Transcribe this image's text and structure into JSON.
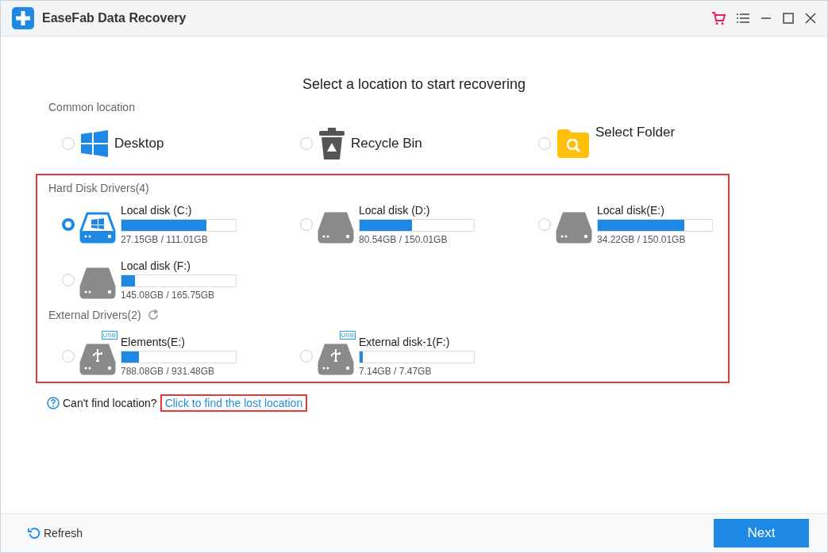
{
  "window": {
    "title": "EaseFab Data Recovery"
  },
  "heading": "Select a location to start recovering",
  "common": {
    "label": "Common location",
    "items": [
      {
        "kind": "desktop",
        "label": "Desktop",
        "selected": false
      },
      {
        "kind": "recycle",
        "label": "Recycle Bin",
        "selected": false
      },
      {
        "kind": "folder",
        "label": "Select Folder",
        "selected": false
      }
    ]
  },
  "hard_disks": {
    "label": "Hard Disk Drivers(4)",
    "highlighted": true,
    "items": [
      {
        "kind": "system",
        "name": "Local disk (C:)",
        "level": 0.74,
        "size": "27.15GB / 111.01GB",
        "selected": true
      },
      {
        "kind": "disk",
        "name": "Local disk (D:)",
        "level": 0.46,
        "size": "80.54GB / 150.01GB",
        "selected": false
      },
      {
        "kind": "disk",
        "name": "Local disk(E:)",
        "level": 0.76,
        "size": "34.22GB / 150.01GB",
        "selected": false
      },
      {
        "kind": "disk",
        "name": "Local disk (F:)",
        "level": 0.12,
        "size": "145.08GB / 165.75GB",
        "selected": false
      }
    ]
  },
  "external": {
    "label": "External Drivers(2)",
    "items": [
      {
        "kind": "usb",
        "badge": "USB",
        "name": "Elements(E:)",
        "level": 0.15,
        "size": "788.08GB / 931.48GB",
        "selected": false
      },
      {
        "kind": "usb",
        "badge": "USB",
        "name": "External disk-1(F:)",
        "level": 0.03,
        "size": "7.14GB / 7.47GB",
        "selected": false
      }
    ]
  },
  "help": {
    "text": "Can't find location?",
    "link": "Click to find the lost location",
    "highlighted": true
  },
  "footer": {
    "refresh": "Refresh",
    "next": "Next"
  }
}
